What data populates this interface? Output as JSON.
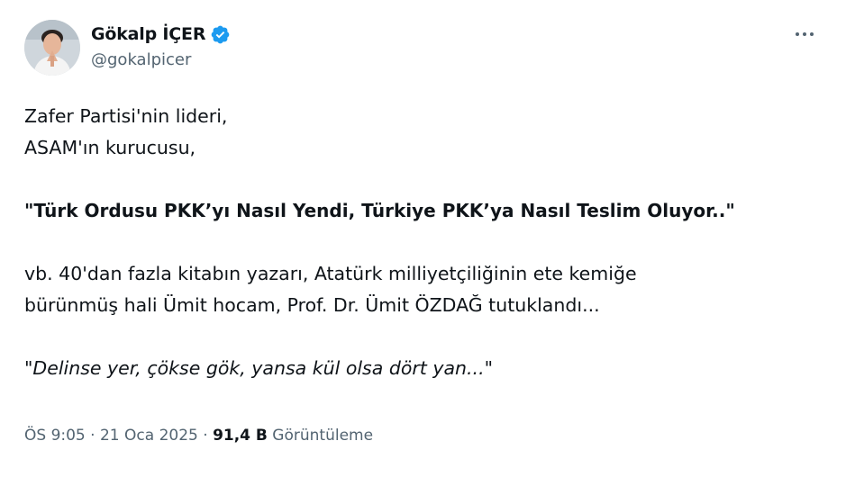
{
  "author": {
    "display_name": "Gökalp İÇER",
    "handle": "@gokalpicer",
    "verified": true,
    "verified_color": "#1d9bf0"
  },
  "icons": {
    "more": "more-horizontal-icon",
    "verified": "verified-badge-icon"
  },
  "tweet": {
    "lines": [
      "Zafer Partisi'nin lideri,",
      "ASAM'ın kurucusu,",
      "\"Türk Ordusu PKK’yı Nasıl Yendi, Türkiye PKK’ya Nasıl Teslim Oluyor..\"",
      "vb. 40'dan fazla kitabın yazarı, Atatürk milliyetçiliğinin ete kemiğe",
      "bürünmüş hali Ümit hocam, Prof. Dr. Ümit ÖZDAĞ tutuklandı...",
      "\"Delinse yer, çökse gök, yansa kül olsa dört yan...\""
    ]
  },
  "meta": {
    "time": "ÖS 9:05",
    "separator": " · ",
    "date": "21 Oca 2025",
    "views_count": "91,4 B",
    "views_label": "Görüntüleme"
  }
}
